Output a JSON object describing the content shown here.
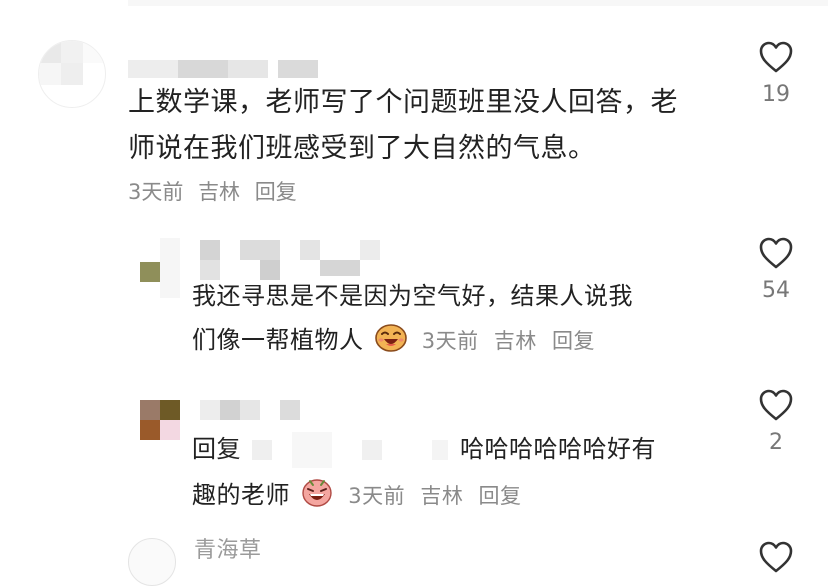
{
  "comments": [
    {
      "text_line1": "上数学课，老师写了个问题班里没人回答，老",
      "text_line2": "师说在我们班感受到了大自然的气息。",
      "time": "3天前",
      "location": "吉林",
      "reply_label": "回复",
      "likes": "19"
    },
    {
      "text_line1": "我还寻思是不是因为空气好，结果人说我",
      "text_line2": "们像一帮植物人",
      "time": "3天前",
      "location": "吉林",
      "reply_label": "回复",
      "likes": "54"
    },
    {
      "reply_prefix": "回复",
      "text_tail": "哈哈哈哈哈哈好有",
      "text_line2": "趣的老师",
      "time": "3天前",
      "location": "吉林",
      "reply_label": "回复",
      "likes": "2"
    }
  ],
  "partial_next_name": "青海草",
  "colors": {
    "text": "#222222",
    "meta": "#8a8a8a",
    "icon_stroke": "#333333"
  },
  "icons": {
    "like": "heart-outline-icon",
    "emoji_laugh": "laughing-face-emoji",
    "emoji_grin": "grinning-face-emoji"
  }
}
